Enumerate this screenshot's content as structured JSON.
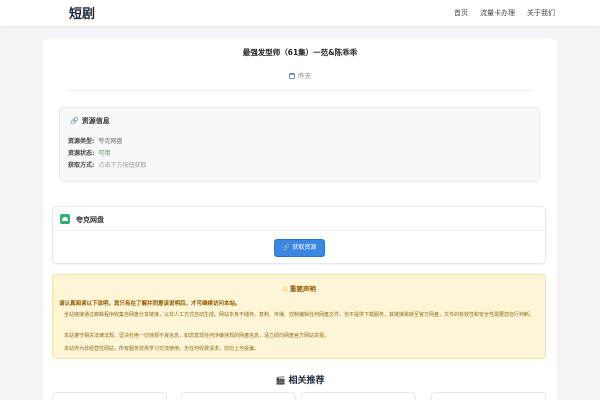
{
  "navbar": {
    "logo": "短剧",
    "links": [
      "首页",
      "流量卡办理",
      "关于我们"
    ]
  },
  "post": {
    "title": "最强发型师（61集）一范&陈乖乖",
    "date": "昨天"
  },
  "resource_info": {
    "heading": "资源信息",
    "rows": [
      {
        "key": "资源类型:",
        "value": "夸克网盘"
      },
      {
        "key": "资源状态:",
        "value": "可用"
      },
      {
        "key": "获取方式:",
        "value": "点击下方按钮获取"
      }
    ]
  },
  "pan": {
    "name": "夸克网盘",
    "button": "获取资源"
  },
  "notice": {
    "title": "重要声明",
    "lead": "请认真阅读以下说明，您只有在了解并同意该说明后，才可继续访问本站。",
    "items": [
      "全站链接通过蜘蛛程序收集自网盘分享链接，以非人工方式自动生成。网站本身不储存、复制、传播、控制编辑任何网盘文件，也不提供下载服务，其链接跳转至官方网盘，文件的有效性和安全性需要您自行判断。",
      "本站遵守相关法律法规，坚决杜绝一切违规不良信息，如您发现任何涉嫌违规的网盘信息，请立即向网盘官方网站举报。",
      "本站作为非经营性网站，所有服务仅供学习交流使用，无任何收费请求，切勿上当受骗。"
    ]
  },
  "related": {
    "title": "相关推荐"
  },
  "colors": {
    "accent": "#3a86e0",
    "success": "#2fa84f",
    "warning_bg": "#fdf5d6"
  }
}
